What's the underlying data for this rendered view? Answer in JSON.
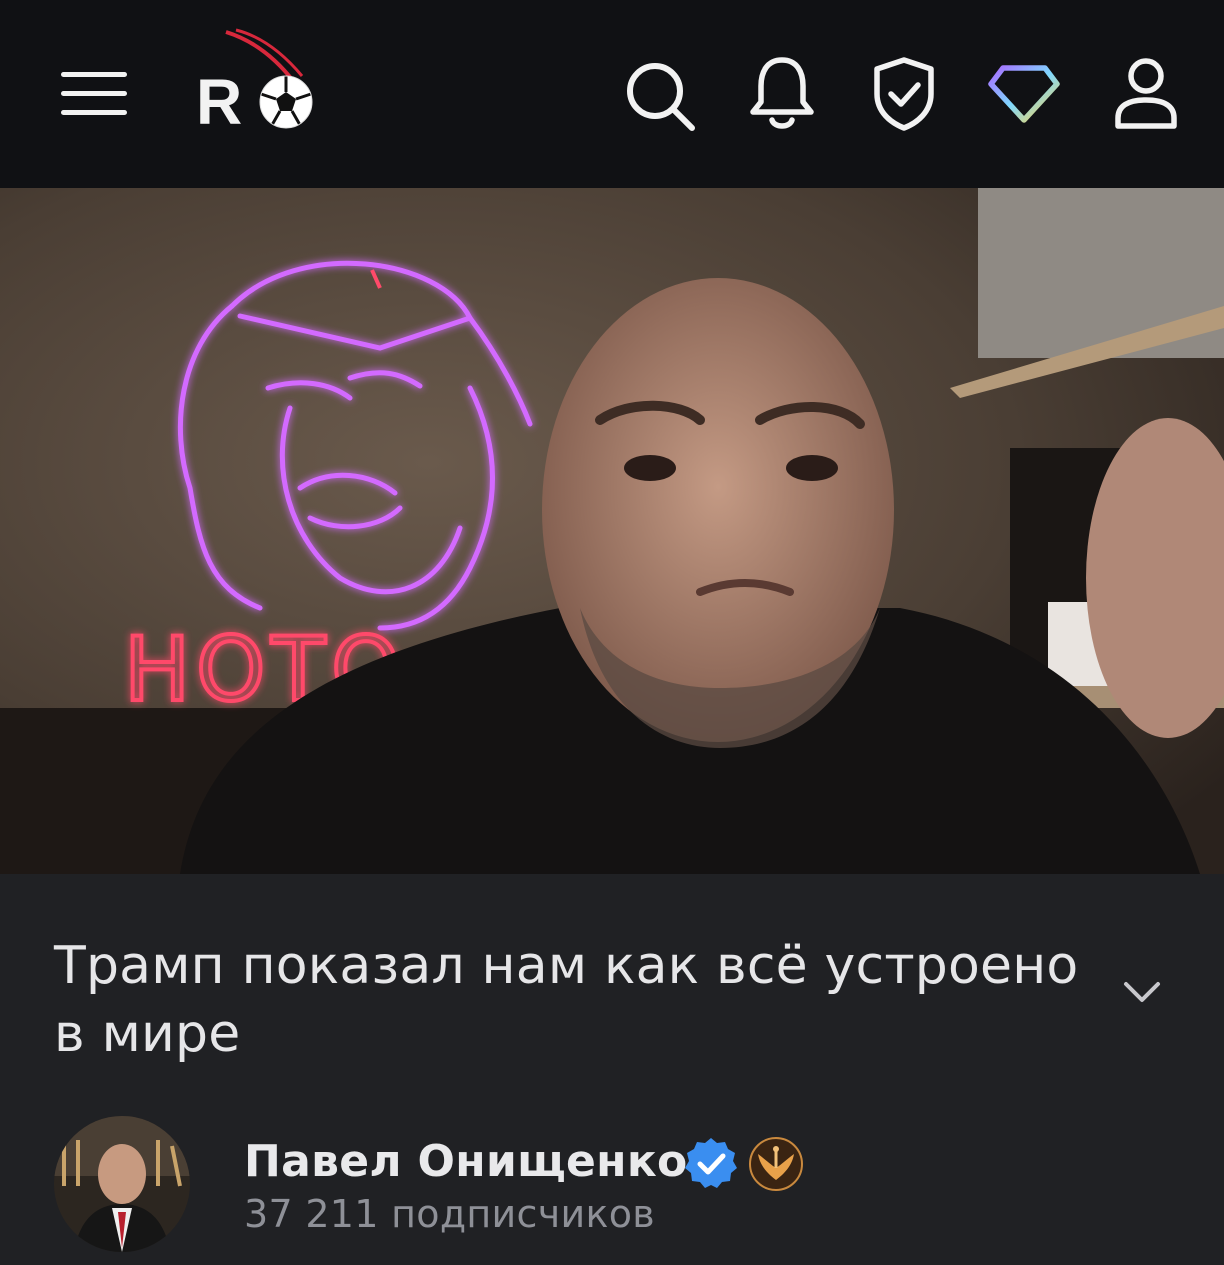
{
  "header": {
    "menu_icon": "hamburger-menu-icon",
    "logo_text": "R",
    "search_icon": "search-icon",
    "notifications_icon": "bell-icon",
    "shield_icon": "shield-check-icon",
    "premium_icon": "diamond-icon",
    "profile_icon": "user-icon"
  },
  "video": {
    "thumbnail_icon": "video-thumbnail",
    "neon_sign_text": "НОТО"
  },
  "main": {
    "title": "Трамп показал нам как всё устроено в мире",
    "expand_icon": "chevron-down-icon"
  },
  "channel": {
    "name": "Павел Онищенко",
    "subscribers": "37 211 подписчиков",
    "verified_icon": "verified-check-icon",
    "badge_icon": "phoenix-badge-icon"
  },
  "colors": {
    "header_bg": "#101114",
    "page_bg": "#202124",
    "verified_blue": "#3a8ef0",
    "neon_purple": "#c060ff",
    "neon_red": "#ff3b5c"
  }
}
